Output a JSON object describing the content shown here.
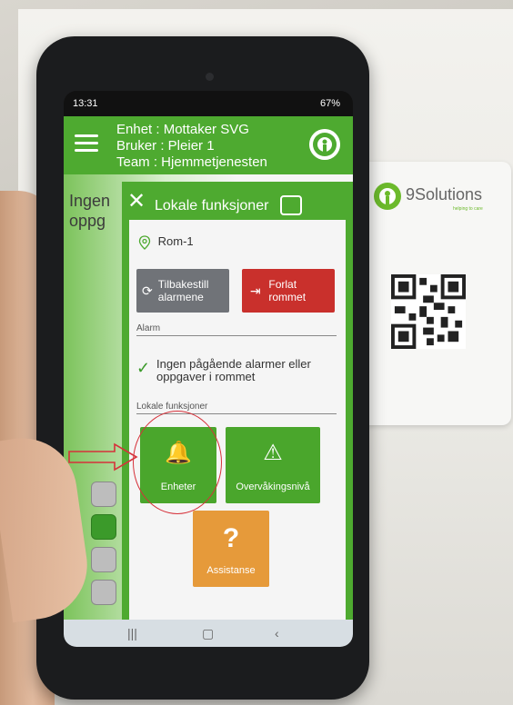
{
  "card": {
    "brand": "9Solutions",
    "tagline": "helping to care"
  },
  "status": {
    "time": "13:31",
    "battery": "67%"
  },
  "header": {
    "line1": "Enhet : Mottaker SVG",
    "line2": "Bruker : Pleier 1",
    "line3": "Team : Hjemmetjenesten"
  },
  "behind": {
    "line1": "Ingen",
    "line2": "oppg"
  },
  "panel": {
    "title": "Lokale funksjoner",
    "room": "Rom-1",
    "reset_label": "Tilbakestill alarmene",
    "leave_label": "Forlat rommet",
    "alarm_section": "Alarm",
    "no_alarm_text": "Ingen pågående alarmer eller oppgaver i rommet",
    "local_section": "Lokale funksjoner",
    "tiles": {
      "enheter": "Enheter",
      "overvak": "Overvåkingsnivå",
      "assist": "Assistanse"
    }
  },
  "colors": {
    "brand_green": "#4eaa30",
    "danger_red": "#c9302c",
    "assist_orange": "#e69a3a",
    "annotation_red": "#d6313a"
  },
  "icons": {
    "bell": "bell-gear-icon",
    "alert": "alert-person-icon",
    "question": "question-icon",
    "location": "location-pin-icon"
  }
}
